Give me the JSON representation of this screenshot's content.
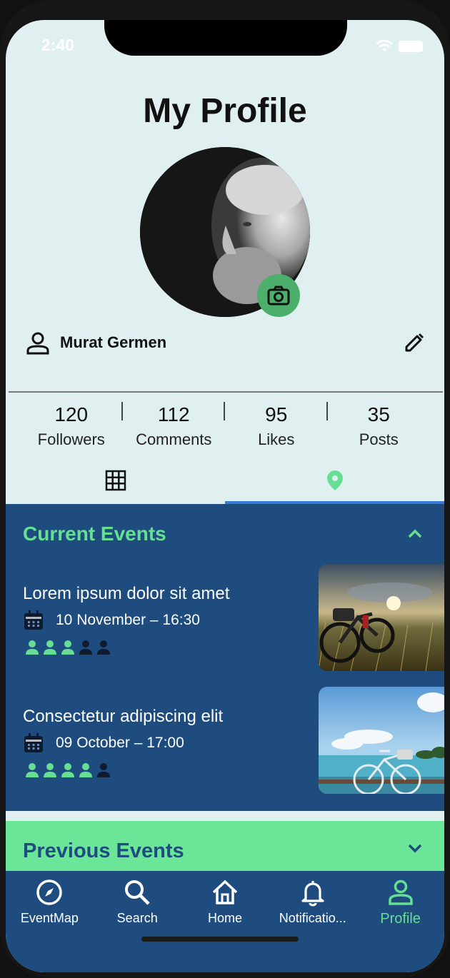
{
  "status": {
    "time": "2:40"
  },
  "header": {
    "title": "My Profile"
  },
  "profile": {
    "name": "Murat Germen"
  },
  "stats": [
    {
      "value": "120",
      "label": "Followers"
    },
    {
      "value": "112",
      "label": "Comments"
    },
    {
      "value": "95",
      "label": "Likes"
    },
    {
      "value": "35",
      "label": "Posts"
    }
  ],
  "tabs": [
    {
      "icon": "grid-icon",
      "active": false
    },
    {
      "icon": "location-pin-icon",
      "active": true
    }
  ],
  "current_events": {
    "title": "Current Events",
    "items": [
      {
        "title": "Lorem ipsum dolor sit amet",
        "date": "10 November – 16:30",
        "attendees_filled": 3,
        "attendees_total": 5
      },
      {
        "title": "Consectetur adipiscing elit",
        "date": "09 October – 17:00",
        "attendees_filled": 4,
        "attendees_total": 5
      }
    ]
  },
  "previous_events": {
    "title": "Previous Events"
  },
  "nav": [
    {
      "label": "EventMap",
      "icon": "compass-icon",
      "active": false
    },
    {
      "label": "Search",
      "icon": "search-icon",
      "active": false
    },
    {
      "label": "Home",
      "icon": "home-icon",
      "active": false
    },
    {
      "label": "Notificatio...",
      "icon": "bell-icon",
      "active": false
    },
    {
      "label": "Profile",
      "icon": "person-icon",
      "active": true
    }
  ],
  "colors": {
    "accent_green": "#66de94",
    "navy": "#1f4c7e",
    "background": "#e0f0f1",
    "tab_indicator": "#3a7bd5"
  }
}
